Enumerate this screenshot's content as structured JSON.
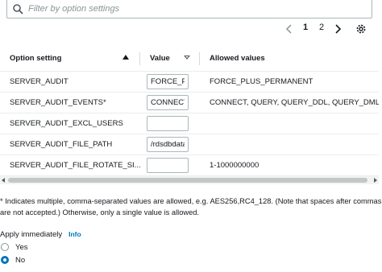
{
  "search": {
    "placeholder": "Filter by option settings",
    "icon": "search-icon"
  },
  "pagination": {
    "pages": [
      "1",
      "2"
    ],
    "current": "1"
  },
  "table": {
    "headers": {
      "option_setting": "Option setting",
      "value": "Value",
      "allowed_values": "Allowed values"
    },
    "rows": [
      {
        "name": "SERVER_AUDIT",
        "value": "FORCE_PLUS_PERMANENT",
        "allowed": "FORCE_PLUS_PERMANENT"
      },
      {
        "name": "SERVER_AUDIT_EVENTS*",
        "value": "CONNECT",
        "allowed": "CONNECT, QUERY, QUERY_DDL, QUERY_DML, QUERY_DCL"
      },
      {
        "name": "SERVER_AUDIT_EXCL_USERS",
        "value": "",
        "allowed": ""
      },
      {
        "name": "SERVER_AUDIT_FILE_PATH",
        "value": "/rdsdbdata",
        "allowed": ""
      },
      {
        "name": "SERVER_AUDIT_FILE_ROTATE_SI...",
        "value": "",
        "allowed": "1-1000000000"
      }
    ]
  },
  "note": "* Indicates multiple, comma-separated values are allowed, e.g. AES256,RC4_128. (Note that spaces after commas are not accepted.) Otherwise, only a single value is allowed.",
  "apply": {
    "label": "Apply immediately",
    "info": "Info",
    "options": [
      {
        "label": "Yes",
        "checked": false
      },
      {
        "label": "No",
        "checked": true
      }
    ]
  },
  "colors": {
    "accent": "#0073bb",
    "border": "#aab7b8",
    "text": "#16191f"
  }
}
